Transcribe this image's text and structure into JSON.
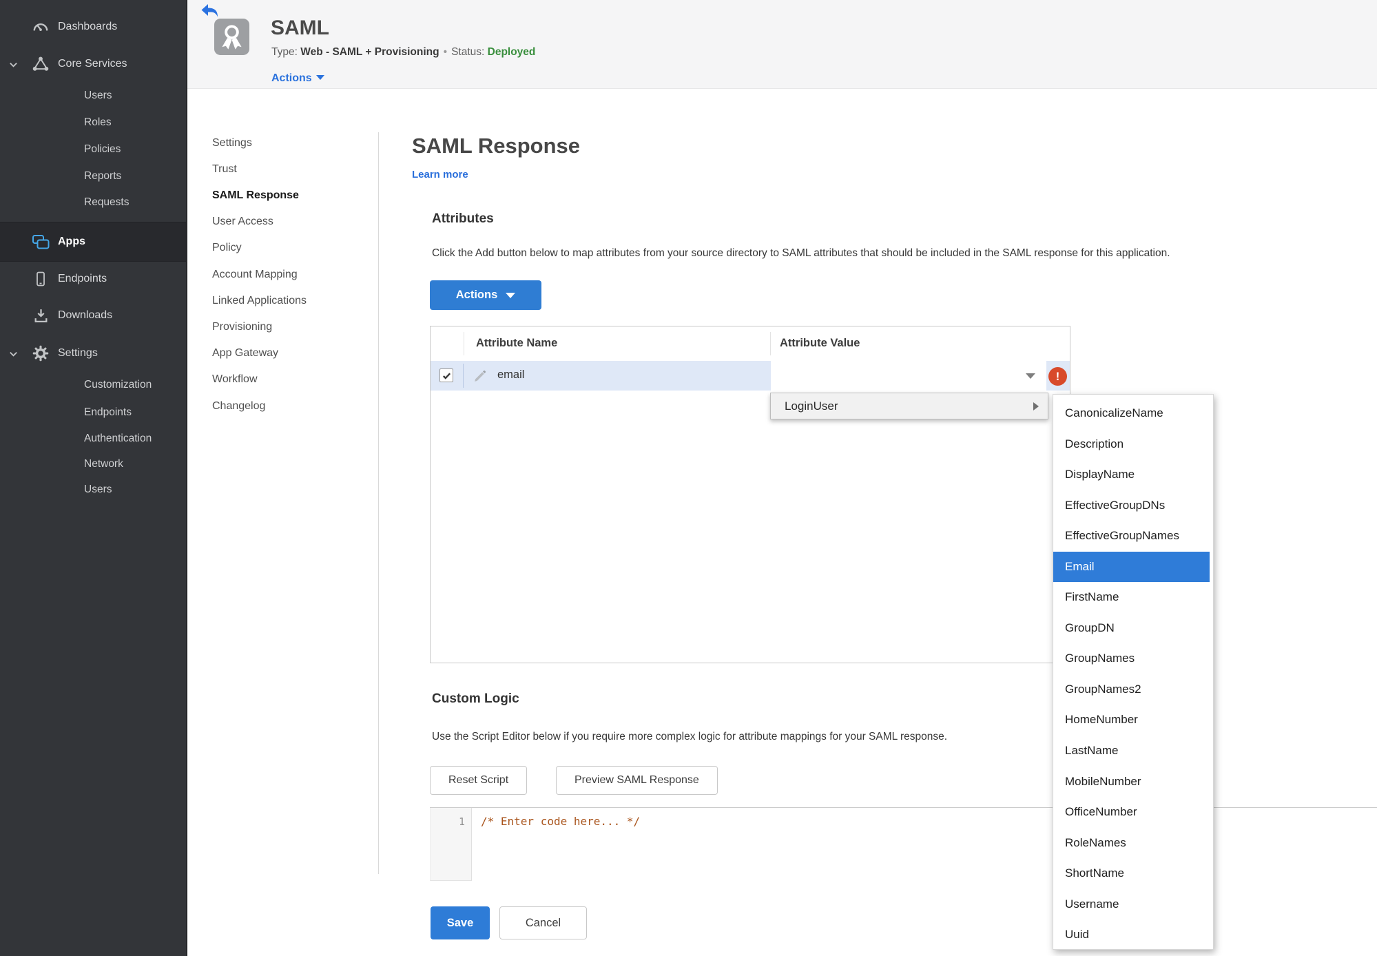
{
  "sidebar": {
    "dashboards": "Dashboards",
    "core_services": "Core Services",
    "core_children": [
      "Users",
      "Roles",
      "Policies",
      "Reports",
      "Requests"
    ],
    "apps": "Apps",
    "endpoints": "Endpoints",
    "downloads": "Downloads",
    "settings": "Settings",
    "settings_children": [
      "Customization",
      "Endpoints",
      "Authentication",
      "Network",
      "Users"
    ]
  },
  "header": {
    "app_title": "SAML",
    "type_label": "Type:",
    "type_value": "Web - SAML + Provisioning",
    "separator": "•",
    "status_label": "Status:",
    "status_value": "Deployed",
    "actions_label": "Actions"
  },
  "subnav": [
    "Settings",
    "Trust",
    "SAML Response",
    "User Access",
    "Policy",
    "Account Mapping",
    "Linked Applications",
    "Provisioning",
    "App Gateway",
    "Workflow",
    "Changelog"
  ],
  "content": {
    "title": "SAML Response",
    "learn_more": "Learn more",
    "attributes_heading": "Attributes",
    "attributes_description": "Click the Add button below to map attributes from your source directory to SAML attributes that should be included in the SAML response for this application.",
    "actions_button": "Actions",
    "table": {
      "col_name": "Attribute Name",
      "col_value": "Attribute Value",
      "row": {
        "name": "email",
        "checked": true,
        "value": ""
      }
    },
    "error_glyph": "!",
    "value_menu": {
      "label": "LoginUser"
    },
    "value_submenu": {
      "items": [
        "CanonicalizeName",
        "Description",
        "DisplayName",
        "EffectiveGroupDNs",
        "EffectiveGroupNames",
        "Email",
        "FirstName",
        "GroupDN",
        "GroupNames",
        "GroupNames2",
        "HomeNumber",
        "LastName",
        "MobileNumber",
        "OfficeNumber",
        "RoleNames",
        "ShortName",
        "Username",
        "Uuid"
      ],
      "selected": "Email"
    },
    "custom_logic_heading": "Custom Logic",
    "custom_logic_description": "Use the Script Editor below if you require more complex logic for attribute mappings for your SAML response.",
    "reset_button": "Reset Script",
    "preview_button": "Preview SAML Response",
    "editor": {
      "line_number": "1",
      "code": "/* Enter code here... */"
    },
    "save_button": "Save",
    "cancel_button": "Cancel"
  },
  "colors": {
    "accent_blue": "#2e7cd7",
    "link_blue": "#2a6fdb",
    "status_green": "#388e3c",
    "error_red": "#d84a2b",
    "row_highlight": "#dfe8f7",
    "selection_blue": "#2f7cd8",
    "sidebar_bg": "#333539",
    "topbar_bg": "#f5f5f6"
  }
}
